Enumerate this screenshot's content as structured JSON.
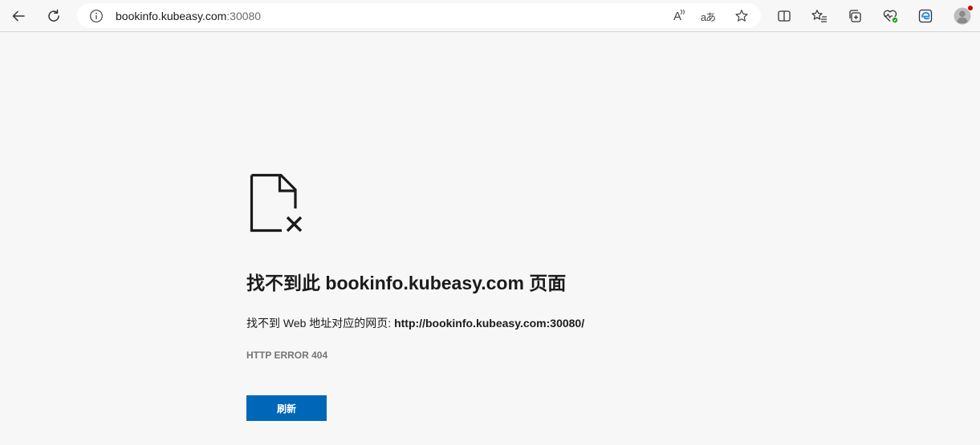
{
  "browser": {
    "url_host": "bookinfo.kubeasy.com",
    "url_port": ":30080",
    "icons": {
      "back": "back-arrow-icon",
      "refresh": "refresh-icon",
      "info": "info-icon",
      "read_aloud": "read-aloud-icon",
      "translate": "translate-icon",
      "favorite": "star-icon",
      "split_screen": "split-screen-icon",
      "favorites": "favorites-list-icon",
      "collections": "collections-icon",
      "browser_essentials": "heart-pulse-icon",
      "edge": "edge-icon",
      "profile": "profile-avatar-icon"
    },
    "translate_glyph": "aあ",
    "read_aloud_glyph": "A"
  },
  "error_page": {
    "title": "找不到此 bookinfo.kubeasy.com 页面",
    "description_prefix": "找不到 Web 地址对应的网页: ",
    "description_url": "http://bookinfo.kubeasy.com:30080/",
    "error_code": "HTTP ERROR 404",
    "refresh_label": "刷新",
    "accent_color": "#0067b8"
  }
}
